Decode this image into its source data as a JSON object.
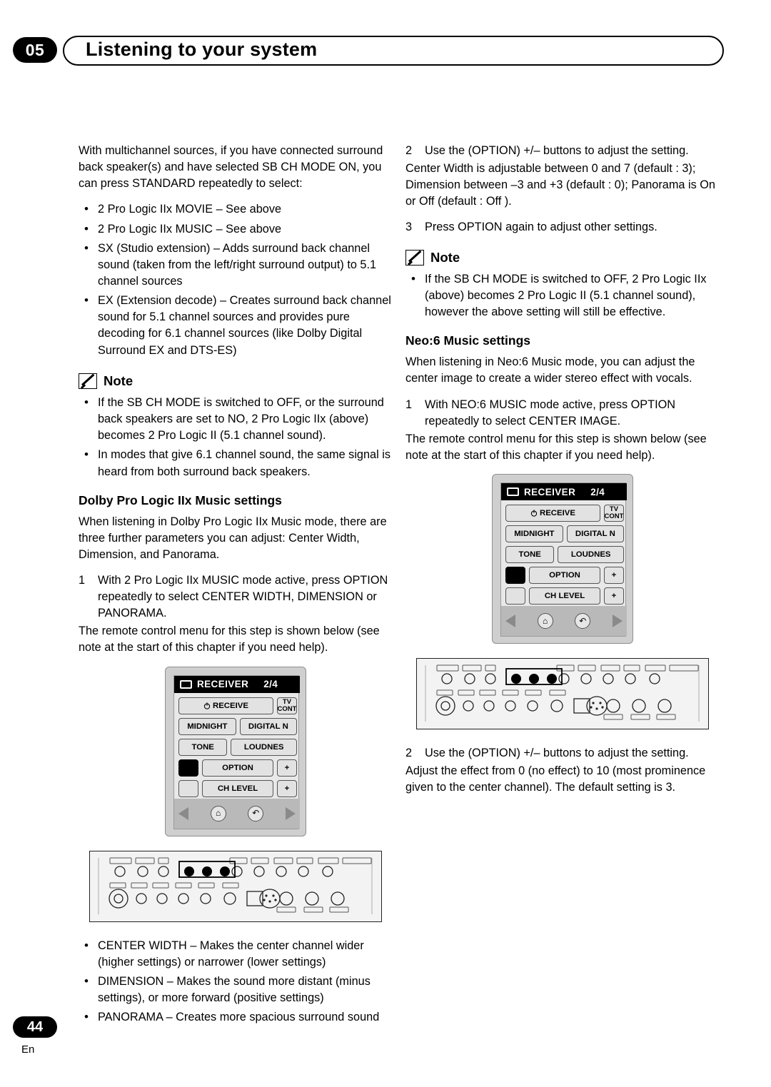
{
  "header": {
    "chapter_number": "05",
    "title": "Listening to your system"
  },
  "footer": {
    "page_number": "44",
    "language": "En"
  },
  "left_column": {
    "intro_paragraph": "With multichannel sources, if you have connected surround back speaker(s) and have selected SB CH MODE ON, you can press STANDARD repeatedly to select:",
    "bullets": [
      "2 Pro Logic IIx MOVIE – See above",
      "2 Pro Logic IIx MUSIC – See above",
      "SX (Studio extension) – Adds surround back channel sound (taken from the left/right surround output) to 5.1 channel sources",
      "EX (Extension decode) – Creates surround back channel sound for 5.1 channel sources and provides pure decoding for 6.1 channel sources (like Dolby Digital Surround EX and DTS-ES)"
    ],
    "note": {
      "label": "Note",
      "items": [
        "If the SB CH MODE is switched to OFF, or the surround back speakers are set to NO, 2 Pro Logic IIx (above) becomes 2 Pro Logic II (5.1 channel sound).",
        "In modes that give 6.1 channel sound, the same signal is heard from both surround back speakers."
      ]
    },
    "section_heading": "Dolby Pro Logic IIx Music settings",
    "section_intro": "When listening in Dolby Pro Logic IIx Music mode, there are three further parameters you can adjust: Center Width, Dimension, and Panorama.",
    "step_1_num": "1",
    "step_1_text": "With 2 Pro Logic IIx MUSIC mode active, press OPTION repeatedly to select CENTER WIDTH, DIMENSION or PANORAMA.",
    "step_1_extra": "The remote control menu for this step is shown below (see note at the start of this chapter if you need help).",
    "trailing_bullets": [
      "CENTER WIDTH – Makes the center channel wider (higher settings) or narrower (lower settings)",
      "DIMENSION – Makes the sound more distant (minus settings), or more forward (positive settings)",
      "PANORAMA – Creates more spacious surround sound"
    ]
  },
  "right_column": {
    "step_2_num": "2",
    "step_2_text": "Use the (OPTION) +/– buttons to adjust the setting.",
    "step_2_detail": "Center Width is adjustable between 0 and 7 (default : 3); Dimension between –3 and +3 (default : 0); Panorama is On or Off (default : Off ).",
    "step_3_num": "3",
    "step_3_text": "Press OPTION again to adjust other settings.",
    "note": {
      "label": "Note",
      "items": [
        "If the SB CH MODE is switched to OFF, 2 Pro Logic IIx (above) becomes 2 Pro Logic II (5.1 channel sound), however the above setting will still be effective."
      ]
    },
    "section_heading": "Neo:6 Music settings",
    "section_intro": "When listening in Neo:6 Music mode, you can adjust the center image to create a wider stereo effect with vocals.",
    "step_1_num": "1",
    "step_1_text": "With NEO:6 MUSIC mode active, press OPTION repeatedly to select CENTER IMAGE.",
    "step_1_extra": "The remote control menu for this step is shown below (see note at the start of this chapter if you need help).",
    "step_2b_num": "2",
    "step_2b_text": "Use the (OPTION) +/– buttons to adjust the setting.",
    "step_2b_detail": "Adjust the effect from 0 (no effect) to 10 (most prominence given to the center channel). The default setting is 3."
  },
  "remote": {
    "title": "RECEIVER",
    "page_indicator": "2/4",
    "tv_icon": "tv-icon",
    "buttons": {
      "receive": "RECEIVE",
      "tv_control_line1": "TV",
      "tv_control_line2": "CONT",
      "midnight": "MIDNIGHT",
      "digital_nr": "DIGITAL N",
      "tone": "TONE",
      "loudness": "LOUDNES",
      "option": "OPTION",
      "plus": "+",
      "ch_level": "CH LEVEL",
      "plus2": "+"
    },
    "nav": {
      "left_arrow": "left-arrow-icon",
      "home": "home-icon",
      "back": "back-icon",
      "right_arrow": "right-arrow-icon"
    },
    "power_icon": "power-icon"
  },
  "colors": {
    "ink": "#000000",
    "paper": "#ffffff",
    "remote_body": "#cfcfcf",
    "remote_face": "#e8e8e8",
    "remote_bottom": "#b9b9b9"
  }
}
